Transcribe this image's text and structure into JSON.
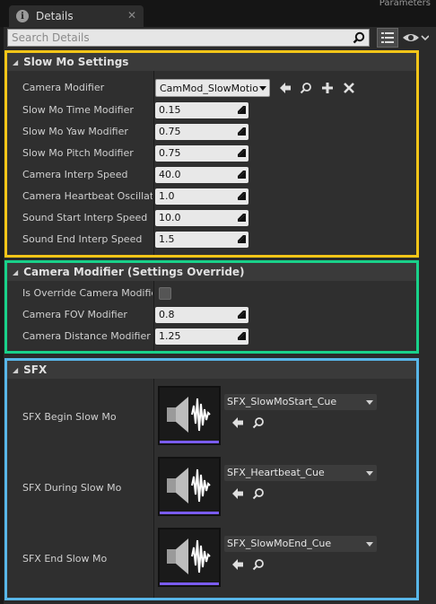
{
  "window": {
    "tab_title": "Details",
    "tab_close": "✕",
    "top_right_fragment": "Parameters"
  },
  "search": {
    "placeholder": "Search Details"
  },
  "colors": {
    "slow_mo_border": "#f5c518",
    "camera_override_border": "#19d18a",
    "sfx_border": "#58b6e8"
  },
  "sections": {
    "slow_mo": {
      "title": "Slow Mo Settings",
      "camera_modifier_label": "Camera Modifier",
      "camera_modifier_value": "CamMod_SlowMotion",
      "fields": [
        {
          "label": "Slow Mo Time Modifier",
          "value": "0.15"
        },
        {
          "label": "Slow Mo Yaw Modifier",
          "value": "0.75"
        },
        {
          "label": "Slow Mo Pitch Modifier",
          "value": "0.75"
        },
        {
          "label": "Camera Interp Speed",
          "value": "40.0"
        },
        {
          "label": "Camera Heartbeat Oscillatio",
          "value": "1.0"
        },
        {
          "label": "Sound Start Interp Speed",
          "value": "10.0"
        },
        {
          "label": "Sound End Interp Speed",
          "value": "1.5"
        }
      ]
    },
    "camera_override": {
      "title": "Camera Modifier (Settings Override)",
      "override_label": "Is Override Camera Modifier",
      "fields": [
        {
          "label": "Camera FOV Modifier",
          "value": "0.8"
        },
        {
          "label": "Camera Distance Modifier",
          "value": "1.25"
        }
      ]
    },
    "sfx": {
      "title": "SFX",
      "items": [
        {
          "label": "SFX Begin Slow Mo",
          "asset": "SFX_SlowMoStart_Cue"
        },
        {
          "label": "SFX During Slow Mo",
          "asset": "SFX_Heartbeat_Cue"
        },
        {
          "label": "SFX End Slow Mo",
          "asset": "SFX_SlowMoEnd_Cue"
        }
      ]
    }
  },
  "icons": [
    "info-icon",
    "close-icon",
    "search-icon",
    "list-view-icon",
    "eye-icon",
    "use-selected-icon",
    "browse-icon",
    "add-icon",
    "clear-icon",
    "drag-handle-icon",
    "sound-cue-icon"
  ]
}
